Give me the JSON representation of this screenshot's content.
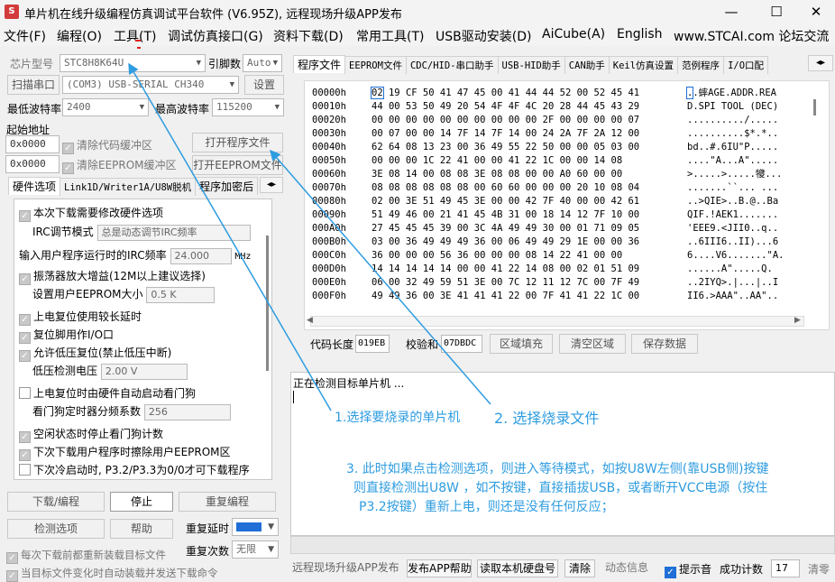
{
  "window": {
    "title": "单片机在线升级编程仿真调试平台软件 (V6.95Z), 远程现场升级APP发布",
    "app_icon": "S",
    "minimize": "—",
    "maximize": "☐",
    "close": "✕"
  },
  "menu": [
    "文件(F)",
    "编程(O)",
    "工具(T)",
    "调试仿真接口(G)",
    "资料下载(D)",
    "常用工具(T)",
    "USB驱动安装(D)",
    "AiCube(A)",
    "English",
    "www.STCAI.com 论坛交流"
  ],
  "left": {
    "chip_label": "芯片型号",
    "chip_value": "STC8H8K64U",
    "pin_label": "引脚数",
    "pin_value": "Auto",
    "scan_button": "扫描串口",
    "port_value": "(COM3) USB-SERIAL CH340",
    "settings_button": "设置",
    "min_baud_label": "最低波特率",
    "min_baud_value": "2400",
    "max_baud_label": "最高波特率",
    "max_baud_value": "115200",
    "start_addr_label": "起始地址",
    "addr1": "0x0000",
    "clear_code_buffer": "清除代码缓冲区",
    "open_program_file": "打开程序文件",
    "addr2": "0x0000",
    "clear_eeprom_buffer": "清除EEPROM缓冲区",
    "open_eeprom_file": "打开EEPROM文件",
    "tabs": [
      "硬件选项",
      "Link1D/Writer1A/U8W脱机",
      "程序加密后"
    ],
    "options": {
      "opt1": "本次下载需要修改硬件选项",
      "irc_mode_label": "IRC调节模式",
      "irc_mode_value": "总是动态调节IRC频率",
      "irc_freq_label": "输入用户程序运行时的IRC频率",
      "irc_freq_value": "24.000",
      "irc_freq_unit": "MHz",
      "opt_osc": "振荡器放大增益(12M以上建议选择)",
      "eeprom_size_label": "设置用户EEPROM大小",
      "eeprom_size_value": "0.5 K",
      "opt_reset_delay": "上电复位使用较长延时",
      "opt_reset_io": "复位脚用作I/O口",
      "opt_lvr": "允许低压复位(禁止低压中断)",
      "lvd_label": "低压检测电压",
      "lvd_value": "2.00 V",
      "opt_wdt": "上电复位时由硬件自动启动看门狗",
      "wdt_div_label": "看门狗定时器分频系数",
      "wdt_div_value": "256",
      "opt_idle_wdt": "空闲状态时停止看门狗计数",
      "opt_erase_eeprom": "下次下载用户程序时擦除用户EEPROM区",
      "opt_cold_boot": "下次冷启动时, P3.2/P3.3为0/0才可下载程序"
    },
    "download_button": "下载/编程",
    "stop_button": "停止",
    "reprogram_button": "重复编程",
    "detect_button": "检测选项",
    "help_button": "帮助",
    "repeat_delay_label": "重复延时",
    "repeat_count_label": "重复次数",
    "repeat_count_value": "无限",
    "reload_each": "每次下载前都重新装载目标文件",
    "auto_reload": "当目标文件变化时自动装载并发送下载命令"
  },
  "right": {
    "tabs": [
      "程序文件",
      "EEPROM文件",
      "CDC/HID-串口助手",
      "USB-HID助手",
      "CAN助手",
      "Keil仿真设置",
      "范例程序",
      "I/O口配"
    ],
    "hex_rows": [
      {
        "addr": "00000h",
        "bytes": "02 19 CF 50 41 47 45 00 41 44 44 52 00 52 45 41",
        "ascii": "..蟀AGE.ADDR.REA"
      },
      {
        "addr": "00010h",
        "bytes": "44 00 53 50 49 20 54 4F 4F 4C 20 28 44 45 43 29",
        "ascii": "D.SPI TOOL (DEC)"
      },
      {
        "addr": "00020h",
        "bytes": "00 00 00 00 00 00 00 00 00 00 2F 00 00 00 00 07",
        "ascii": "........../....."
      },
      {
        "addr": "00030h",
        "bytes": "00 07 00 00 14 7F 14 7F 14 00 24 2A 7F 2A 12 00",
        "ascii": "..........$*.*.."
      },
      {
        "addr": "00040h",
        "bytes": "62 64 08 13 23 00 36 49 55 22 50 00 00 05 03 00",
        "ascii": "bd..#.6IU\"P....."
      },
      {
        "addr": "00050h",
        "bytes": "00 00 00 1C 22 41 00 00 41 22 1C 00 00 14 08",
        "ascii": "....\"A...A\"....."
      },
      {
        "addr": "00060h",
        "bytes": "3E 08 14 00 08 08 3E 08 08 00 00 A0 60 00 00",
        "ascii": ">.....>.....犪..."
      },
      {
        "addr": "00070h",
        "bytes": "08 08 08 08 08 08 00 60 60 00 00 00 20 10 08 04",
        "ascii": ".......``... ..."
      },
      {
        "addr": "00080h",
        "bytes": "02 00 3E 51 49 45 3E 00 00 42 7F 40 00 00 42 61",
        "ascii": "..>QIE>..B.@..Ba"
      },
      {
        "addr": "00090h",
        "bytes": "51 49 46 00 21 41 45 4B 31 00 18 14 12 7F 10 00",
        "ascii": "QIF.!AEK1......."
      },
      {
        "addr": "000A0h",
        "bytes": "27 45 45 45 39 00 3C 4A 49 49 30 00 01 71 09 05",
        "ascii": "'EEE9.<JII0..q.."
      },
      {
        "addr": "000B0h",
        "bytes": "03 00 36 49 49 49 36 00 06 49 49 29 1E 00 00 36",
        "ascii": "..6III6..II)...6"
      },
      {
        "addr": "000C0h",
        "bytes": "36 00 00 00 56 36 00 00 00 08 14 22 41 00 00",
        "ascii": "6....V6.......\"A."
      },
      {
        "addr": "000D0h",
        "bytes": "14 14 14 14 14 00 00 41 22 14 08 00 02 01 51 09",
        "ascii": "......A\".....Q."
      },
      {
        "addr": "000E0h",
        "bytes": "06 00 32 49 59 51 3E 00 7C 12 11 12 7C 00 7F 49",
        "ascii": "..2IYQ>.|...|..I"
      },
      {
        "addr": "000F0h",
        "bytes": "49 49 36 00 3E 41 41 41 22 00 7F 41 41 22 1C 00",
        "ascii": "II6.>AAA\"..AA\".."
      }
    ],
    "code_len_label": "代码长度",
    "code_len_value": "019EB",
    "checksum_label": "校验和",
    "checksum_value": "07DBDC",
    "fill_button": "区域填充",
    "clear_button": "清空区域",
    "save_button": "保存数据",
    "log_text": "正在检测目标单片机 ..."
  },
  "status": {
    "publish_app": "远程现场升级APP发布",
    "publish_help": "发布APP帮助",
    "read_disk": "读取本机硬盘号",
    "clear": "清除",
    "dynamic_info": "动态信息",
    "beep": "提示音",
    "success_label": "成功计数",
    "success_value": "17",
    "clear2": "清零"
  },
  "annotations": {
    "step1": "1.选择要烧录的单片机",
    "step2": "2. 选择烧录文件",
    "step3_line1": "3. 此时如果点击检测选项，则进入等待模式，如按U8W左侧(靠USB侧)按键",
    "step3_line2": "则直接检测出U8W ，如不按键，直接插拔USB，或者断开VCC电源（按住",
    "step3_line3": "P3.2按键）重新上电，则还是没有任何反应；"
  },
  "colors": {
    "annotation": "#2e9ce0",
    "highlight": "#1f6fd6",
    "red_mark": "#e02020"
  }
}
